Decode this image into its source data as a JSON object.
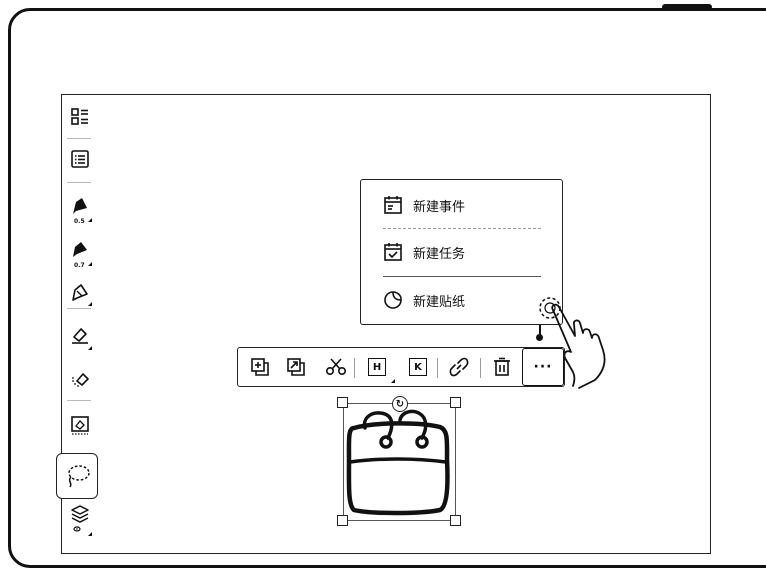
{
  "toolbar": {
    "pen_sizes": [
      "0.5",
      "0.7"
    ]
  },
  "menu": {
    "items": [
      {
        "label": "新建事件",
        "icon": "calendar-event-icon"
      },
      {
        "label": "新建任务",
        "icon": "calendar-task-icon"
      },
      {
        "label": "新建贴纸",
        "icon": "sticker-icon"
      }
    ]
  },
  "context_toolbar": {
    "heading_key": "H",
    "keyword_key": "K",
    "more_label": "···",
    "icons": [
      "copy-icon",
      "export-icon",
      "cut-icon",
      "heading-icon",
      "keyword-icon",
      "link-icon",
      "delete-icon",
      "more-icon"
    ]
  },
  "selection": {
    "rotate_label": "↻"
  }
}
